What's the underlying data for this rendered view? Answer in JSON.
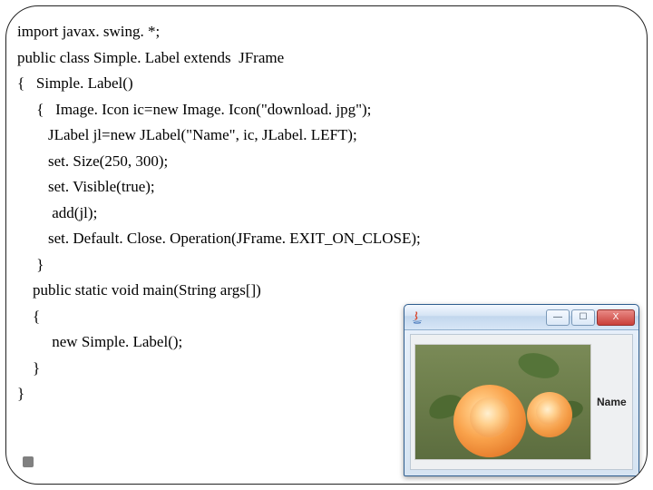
{
  "code": {
    "l1": "import javax. swing. *;",
    "l2": "public class Simple. Label extends  JFrame",
    "l3": "{   Simple. Label()",
    "l4": "     {   Image. Icon ic=new Image. Icon(\"download. jpg\");",
    "l5": "        JLabel jl=new JLabel(\"Name\", ic, JLabel. LEFT);",
    "l6": "        set. Size(250, 300);",
    "l7": "        set. Visible(true);",
    "l8": "         add(jl);",
    "l9": "        set. Default. Close. Operation(JFrame. EXIT_ON_CLOSE);",
    "l10": "     }",
    "l11": "    public static void main(String args[])",
    "l12": "    {",
    "l13": "         new Simple. Label();",
    "l14": "    }",
    "l15": "}"
  },
  "window": {
    "title": "",
    "label": "Name",
    "buttons": {
      "min": "—",
      "max": "☐",
      "close": "X"
    }
  }
}
